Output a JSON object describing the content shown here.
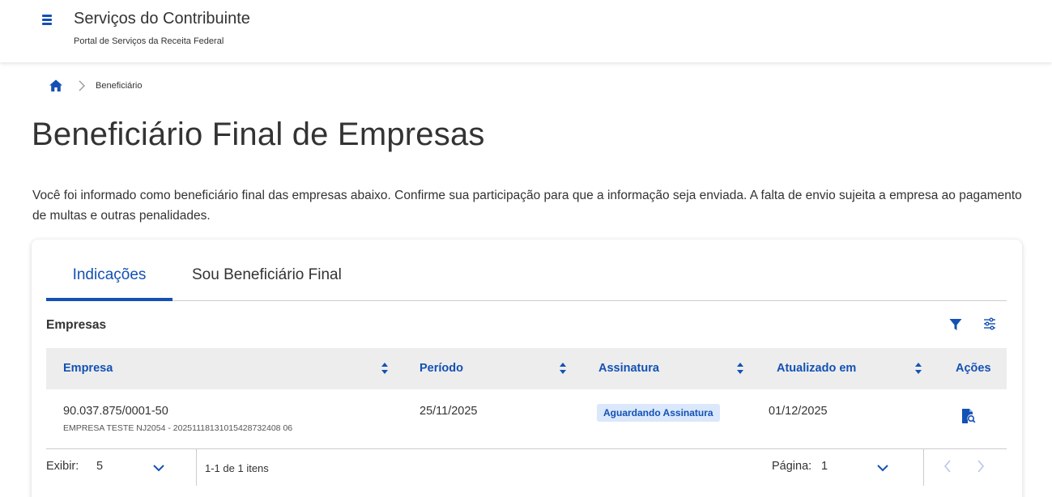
{
  "header": {
    "title": "Serviços do Contribuinte",
    "subtitle": "Portal de Serviços da Receita Federal"
  },
  "breadcrumb": {
    "current": "Beneficiário"
  },
  "page": {
    "title": "Beneficiário Final de Empresas",
    "description": "Você foi informado como beneficiário final das empresas abaixo. Confirme sua participação para que a informação seja enviada. A falta de envio sujeita a empresa ao pagamento de multas e outras penalidades."
  },
  "tabs": [
    {
      "label": "Indicações",
      "active": true
    },
    {
      "label": "Sou Beneficiário Final",
      "active": false
    }
  ],
  "table": {
    "title": "Empresas",
    "columns": [
      "Empresa",
      "Período",
      "Assinatura",
      "Atualizado em",
      "Ações"
    ],
    "rows": [
      {
        "cnpj": "90.037.875/0001-50",
        "empresa_detail": "EMPRESA TESTE NJ2054 - 20251118131015428732408 06",
        "periodo": "25/11/2025",
        "assinatura": "Aguardando Assinatura",
        "atualizado": "01/12/2025"
      }
    ]
  },
  "pagination": {
    "exibir_label": "Exibir:",
    "exibir_value": "5",
    "range_text": "1-1 de 1 itens",
    "pagina_label": "Página:",
    "pagina_value": "1"
  },
  "colors": {
    "primary": "#1351b4",
    "badge_bg": "#dbe8fb",
    "header_bg": "#ededed",
    "text": "#333333"
  }
}
